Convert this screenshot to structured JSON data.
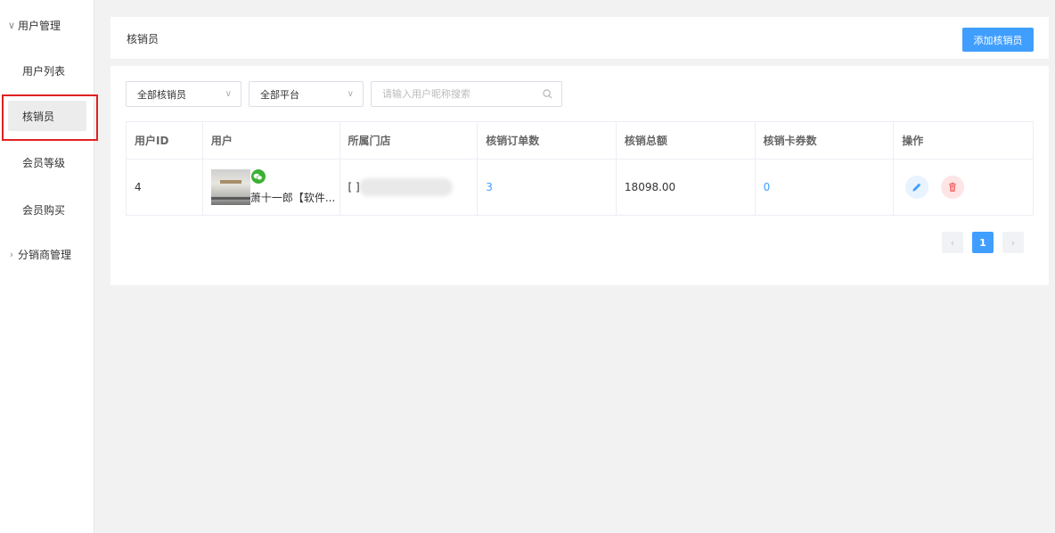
{
  "sidebar": {
    "group1_label": "用户管理",
    "items": [
      {
        "label": "用户列表"
      },
      {
        "label": "核销员"
      },
      {
        "label": "会员等级"
      },
      {
        "label": "会员购买"
      }
    ],
    "group2_label": "分销商管理"
  },
  "header": {
    "title": "核销员",
    "add_button": "添加核销员"
  },
  "filters": {
    "verifier_select": "全部核销员",
    "platform_select": "全部平台",
    "search_placeholder": "请输入用户昵称搜索"
  },
  "table": {
    "columns": [
      "用户ID",
      "用户",
      "所属门店",
      "核销订单数",
      "核销总额",
      "核销卡券数",
      "操作"
    ],
    "rows": [
      {
        "id": "4",
        "user_name": "萧十一郎【软件...",
        "store": "[                          ]",
        "order_count": "3",
        "total_amount": "18098.00",
        "coupon_count": "0"
      }
    ]
  },
  "pagination": {
    "current_page": "1",
    "prev": "‹",
    "next": "›"
  },
  "colors": {
    "primary": "#409eff",
    "danger": "#f56c6c",
    "wechat": "#3cb034",
    "highlight": "#e02020"
  }
}
